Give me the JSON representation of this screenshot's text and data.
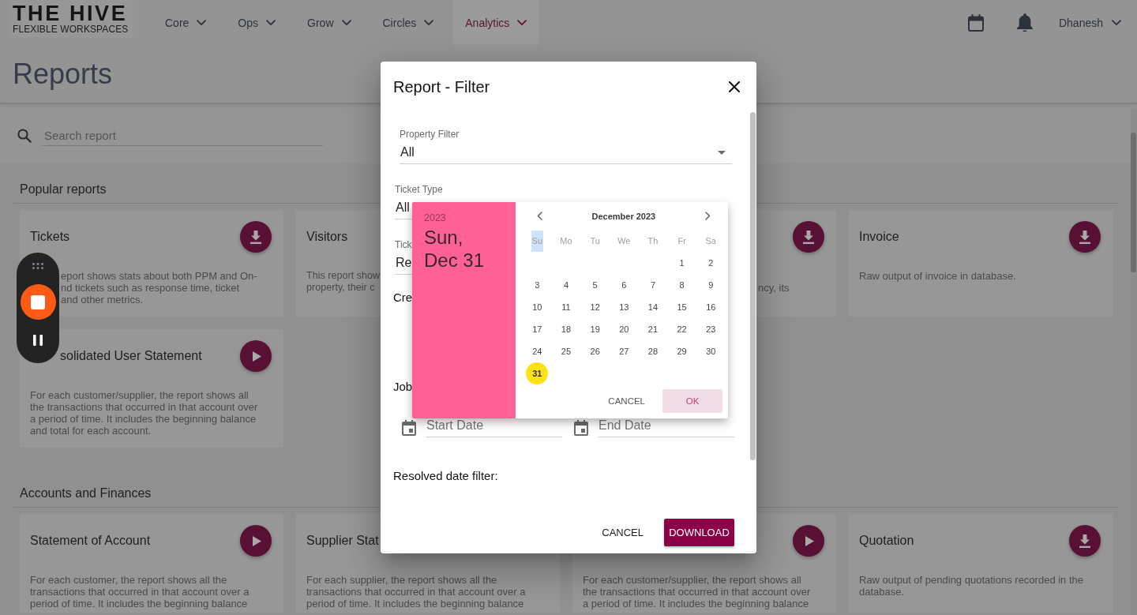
{
  "top_nav": {
    "logo": {
      "title": "THE HIVE",
      "subtitle": "FLEXIBLE WORKSPACES"
    },
    "menus": [
      {
        "label": "Core",
        "selected": false
      },
      {
        "label": "Ops",
        "selected": false
      },
      {
        "label": "Grow",
        "selected": false
      },
      {
        "label": "Circles",
        "selected": false
      },
      {
        "label": "Analytics",
        "selected": true
      }
    ],
    "user": {
      "name": "Dhanesh"
    }
  },
  "page": {
    "title": "Reports"
  },
  "search": {
    "placeholder": "Search report"
  },
  "sections": [
    {
      "title": "Popular reports",
      "cards": [
        {
          "title": "Tickets",
          "description": "eport shows stats about both PPM and On-\nnd tickets such as response time, ticket\nand other metrics.",
          "kind": "download"
        },
        {
          "title": "Visitors",
          "description": "This report show\nproperty, their c"
        },
        {
          "description": "ncy, its",
          "kind": "download"
        },
        {
          "title": "Invoice",
          "description": "Raw output of invoice in database.",
          "kind": "download"
        },
        {
          "title": "solidated User Statement",
          "description": "For each customer/supplier, the report shows all the transactions that occurred in that account over a period of time. It includes the beginning balance and total for each account.",
          "kind": "run"
        }
      ]
    },
    {
      "title": "Accounts and Finances",
      "cards": [
        {
          "title": "Statement of Account",
          "description": "For each customer, the report shows all the transactions that occurred in that account over a period of time. It includes the beginning balance",
          "kind": "run"
        },
        {
          "title": "Supplier Stat",
          "description": "For each supplier, the report shows all the transactions that occurred in that account over a period of time. It includes the beginning balance"
        },
        {
          "description": "For each customer/supplier, the report shows all the transactions that occurred in that account over a period of time. It includes the beginning balance",
          "kind": "run"
        },
        {
          "title": "Quotation",
          "description": "Raw output of pending quotations recorded in the database.",
          "kind": "download"
        }
      ]
    }
  ],
  "dialog": {
    "title": "Report - Filter",
    "filters": [
      {
        "kind": "select",
        "label": "Property Filter",
        "value": "All"
      },
      {
        "kind": "select",
        "label": "Ticket Type",
        "value": "All"
      },
      {
        "kind": "select",
        "label": "Tick",
        "value": "Re"
      },
      {
        "kind": "date_range",
        "title": "Cre"
      },
      {
        "kind": "date_range",
        "title": "Job",
        "start": {
          "placeholder": "Start Date"
        },
        "end": {
          "placeholder": "End Date"
        }
      },
      {
        "kind": "date_range",
        "title": "Resolved date filter:"
      }
    ],
    "buttons": [
      {
        "kind": "text",
        "label": "CANCEL"
      },
      {
        "kind": "contained",
        "label": "DOWNLOAD"
      }
    ]
  },
  "date_picker": {
    "year": "2023",
    "date": "Sun, Dec 31",
    "month": "December 2023",
    "weekdays": [
      {
        "label": "Su",
        "highlighted": true
      },
      {
        "label": "Mo",
        "highlighted": false
      },
      {
        "label": "Tu",
        "highlighted": false
      },
      {
        "label": "We",
        "highlighted": false
      },
      {
        "label": "Th",
        "highlighted": false
      },
      {
        "label": "Fr",
        "highlighted": false
      },
      {
        "label": "Sa",
        "highlighted": false
      }
    ],
    "weeks": [
      [
        {
          "label": "1",
          "selected": false
        },
        {
          "label": "2",
          "selected": false
        }
      ],
      [
        {
          "label": "3",
          "selected": false
        },
        {
          "label": "4",
          "selected": false
        },
        {
          "label": "5",
          "selected": false
        },
        {
          "label": "6",
          "selected": false
        },
        {
          "label": "7",
          "selected": false
        },
        {
          "label": "8",
          "selected": false
        },
        {
          "label": "9",
          "selected": false
        }
      ],
      [
        {
          "label": "10",
          "selected": false
        },
        {
          "label": "11",
          "selected": false
        },
        {
          "label": "12",
          "selected": false
        },
        {
          "label": "13",
          "selected": false
        },
        {
          "label": "14",
          "selected": false
        },
        {
          "label": "15",
          "selected": false
        },
        {
          "label": "16",
          "selected": false
        }
      ],
      [
        {
          "label": "17",
          "selected": false
        },
        {
          "label": "18",
          "selected": false
        },
        {
          "label": "19",
          "selected": false
        },
        {
          "label": "20",
          "selected": false
        },
        {
          "label": "21",
          "selected": false
        },
        {
          "label": "22",
          "selected": false
        },
        {
          "label": "23",
          "selected": false
        }
      ],
      [
        {
          "label": "24",
          "selected": false
        },
        {
          "label": "25",
          "selected": false
        },
        {
          "label": "26",
          "selected": false
        },
        {
          "label": "27",
          "selected": false
        },
        {
          "label": "28",
          "selected": false
        },
        {
          "label": "29",
          "selected": false
        },
        {
          "label": "30",
          "selected": false
        }
      ],
      [
        {
          "label": "31",
          "selected": true
        }
      ]
    ],
    "buttons": [
      {
        "label": "CANCEL",
        "focused": false
      },
      {
        "label": "OK",
        "focused": true
      }
    ]
  }
}
